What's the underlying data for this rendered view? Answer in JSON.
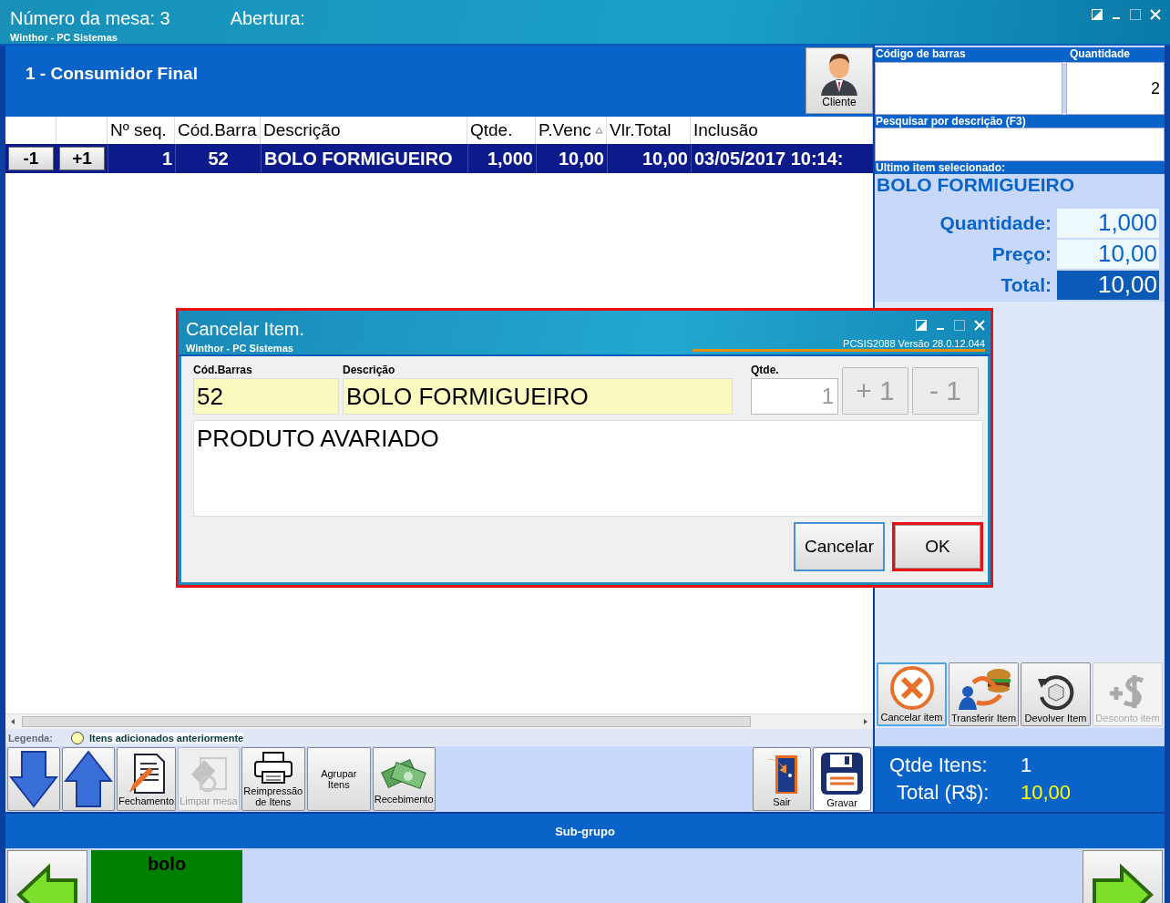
{
  "window": {
    "title": "Número da mesa: 3",
    "opening_label": "Abertura:",
    "subtitle": "Winthor - PC Sistemas"
  },
  "customer": {
    "name": "1 - Consumidor Final",
    "button": "Cliente"
  },
  "table": {
    "columns": [
      {
        "label": "Nº seq.",
        "sorted": false
      },
      {
        "label": "Cód.Barra",
        "sorted": false
      },
      {
        "label": "Descrição",
        "sorted": false
      },
      {
        "label": "Qtde.",
        "sorted": false
      },
      {
        "label": "P.Venc",
        "sorted": true
      },
      {
        "label": "Vlr.Total",
        "sorted": false
      },
      {
        "label": "Inclusão",
        "sorted": false
      }
    ],
    "rows": [
      {
        "minus": "-1",
        "plus": "+1",
        "cells": [
          "1",
          "52",
          "BOLO FORMIGUEIRO",
          "1,000",
          "10,00",
          "10,00",
          "03/05/2017 10:14:"
        ],
        "selected": true
      }
    ]
  },
  "legend": {
    "label": "Legenda:",
    "text": "Itens adicionados anteriormente"
  },
  "toolbar": [
    {
      "kind": "down",
      "disabled": false
    },
    {
      "kind": "up",
      "disabled": false
    },
    {
      "kind": "document",
      "label": "Fechamento",
      "disabled": false
    },
    {
      "kind": "eraser",
      "label": "Limpar mesa",
      "disabled": true
    },
    {
      "kind": "printer",
      "label": "Reimpressão de Itens",
      "disabled": false
    },
    {
      "kind": "text",
      "label": "Agrupar Itens",
      "disabled": false
    },
    {
      "kind": "money",
      "label": "Recebimento",
      "disabled": false
    }
  ],
  "toolbar_right": [
    {
      "kind": "door",
      "label": "Sair",
      "focused": false
    },
    {
      "kind": "floppy",
      "label": "Gravar",
      "focused": true
    }
  ],
  "right_panel": {
    "barcode_label": "Código de barras",
    "quantity_label": "Quantidade",
    "quantity_value": "2",
    "search_label": "Pesquisar por descrição (F3)",
    "last_item_label": "Ultimo item selecionado:",
    "last_item_name": "BOLO FORMIGUEIRO",
    "details": [
      {
        "label": "Quantidade:",
        "value": "1,000",
        "highlighted": false
      },
      {
        "label": "Preço:",
        "value": "10,00",
        "highlighted": false
      },
      {
        "label": "Total:",
        "value": "10,00",
        "highlighted": true
      }
    ]
  },
  "actions": [
    {
      "kind": "cancel",
      "label": "Cancelar item",
      "disabled": false,
      "focused": true
    },
    {
      "kind": "transfer",
      "label": "Transferir Item",
      "disabled": false,
      "focused": false
    },
    {
      "kind": "return",
      "label": "Devolver Item",
      "disabled": false,
      "focused": false
    },
    {
      "kind": "discount",
      "label": "Desconto item",
      "disabled": true,
      "focused": false
    }
  ],
  "totals": [
    {
      "label": "Qtde Itens:",
      "value": "1",
      "color": "#ffffff"
    },
    {
      "label": "Total (R$):",
      "value": "10,00",
      "color": "#ffff00"
    }
  ],
  "subgroup": {
    "title": "Sub-grupo",
    "items": [
      {
        "label": "bolo",
        "color": "#008000"
      }
    ]
  },
  "dialog": {
    "title": "Cancelar Item.",
    "subtitle": "Winthor - PC Sistemas",
    "version": "PCSIS2088  Versão  28.0.12.044",
    "barcode_label": "Cód.Barras",
    "barcode": "52",
    "description_label": "Descrição",
    "description": "BOLO FORMIGUEIRO",
    "quantity_label": "Qtde.",
    "quantity": "1",
    "plus": "+ 1",
    "minus": "- 1",
    "reason": "PRODUTO AVARIADO",
    "cancel": "Cancelar",
    "ok": "OK",
    "ok_highlighted": true
  }
}
